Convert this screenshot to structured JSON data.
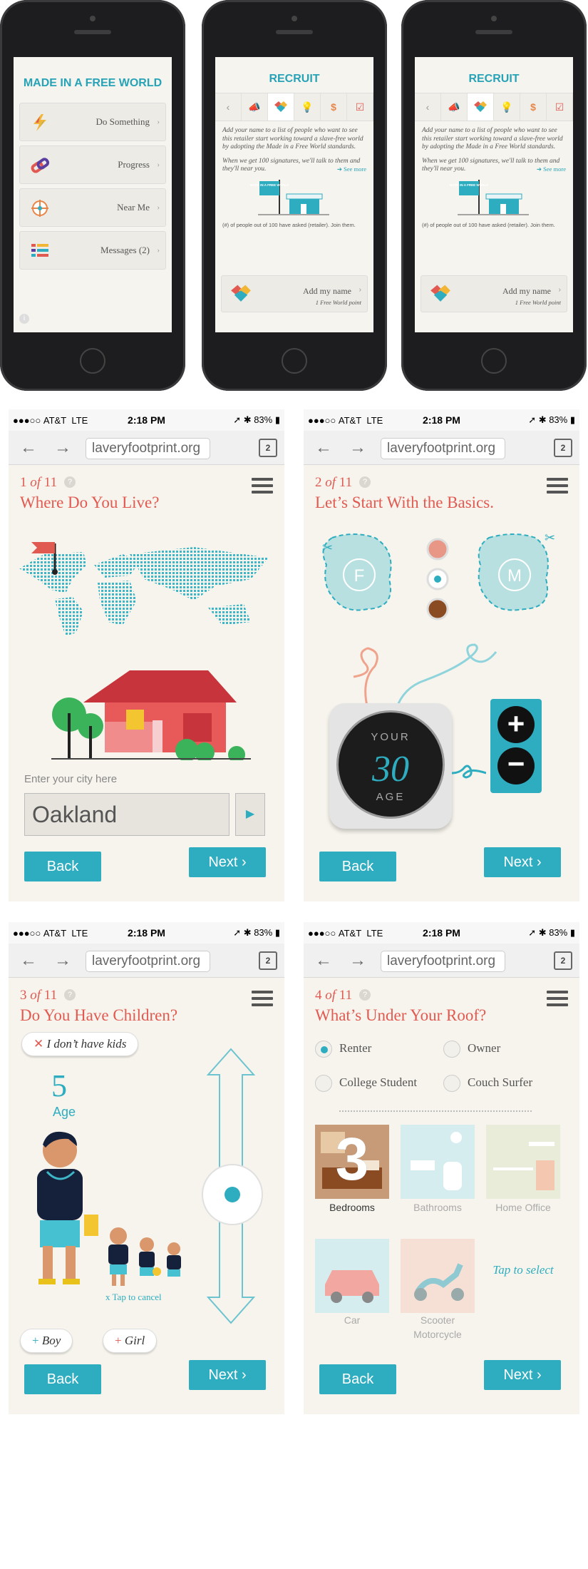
{
  "phone1": {
    "title": "MADE IN A FREE WORLD",
    "menu": [
      {
        "label": "Do Something",
        "icon": "lightning-icon"
      },
      {
        "label": "Progress",
        "icon": "chain-link-icon"
      },
      {
        "label": "Near Me",
        "icon": "compass-icon"
      },
      {
        "label": "Messages (2)",
        "icon": "list-icon"
      }
    ],
    "info": "i"
  },
  "recruit": {
    "title": "RECRUIT",
    "body1": "Add your name to a list of people who want to see this retailer start working toward a slave-free world by adopting the Made in a Free World standards.",
    "body2": "When we get 100 signatures, we'll talk to them and they'll near you.",
    "see_more": "See more",
    "flag_text": "MADE IN A FREE WORLD",
    "count_text": "(#) of people out of 100 have asked (retailer). Join them.",
    "add_label": "Add my name",
    "point_label": "1 Free World point"
  },
  "status": {
    "carrier": "AT&T",
    "network": "LTE",
    "time": "2:18 PM",
    "battery": "83%"
  },
  "browser": {
    "url": "laveryfootprint.org",
    "tabs": "2"
  },
  "common": {
    "back": "Back",
    "next": "Next",
    "of": "of",
    "total": "11",
    "help": "?"
  },
  "step1": {
    "num": "1",
    "title": "Where Do You Live?",
    "city_placeholder": "Enter your city here",
    "city_value": "Oakland"
  },
  "step2": {
    "num": "2",
    "title": "Let’s Start With the Basics.",
    "female": "F",
    "male": "M",
    "age_top": "YOUR",
    "age_value": "30",
    "age_bottom": "AGE"
  },
  "step3": {
    "num": "3",
    "title": "Do You Have Children?",
    "no_kids": "I don’t have kids",
    "kids_count": "5",
    "kids_caption": "Age",
    "tap_cancel": "x Tap to cancel",
    "boy": "Boy",
    "girl": "Girl"
  },
  "step4": {
    "num": "4",
    "title": "What’s Under Your Roof?",
    "options": [
      {
        "label": "Renter",
        "selected": true
      },
      {
        "label": "Owner",
        "selected": false
      },
      {
        "label": "College Student",
        "selected": false
      },
      {
        "label": "Couch Surfer",
        "selected": false
      }
    ],
    "bedrooms_count": "3",
    "rooms": [
      "Bedrooms",
      "Bathrooms",
      "Home Office",
      "Car",
      "Scooter",
      "Motorcycle"
    ],
    "tap_select": "Tap to select"
  },
  "colors": {
    "accent": "#2eadc0",
    "title_red": "#e15a52",
    "panel_bg": "#f6f4ec"
  }
}
